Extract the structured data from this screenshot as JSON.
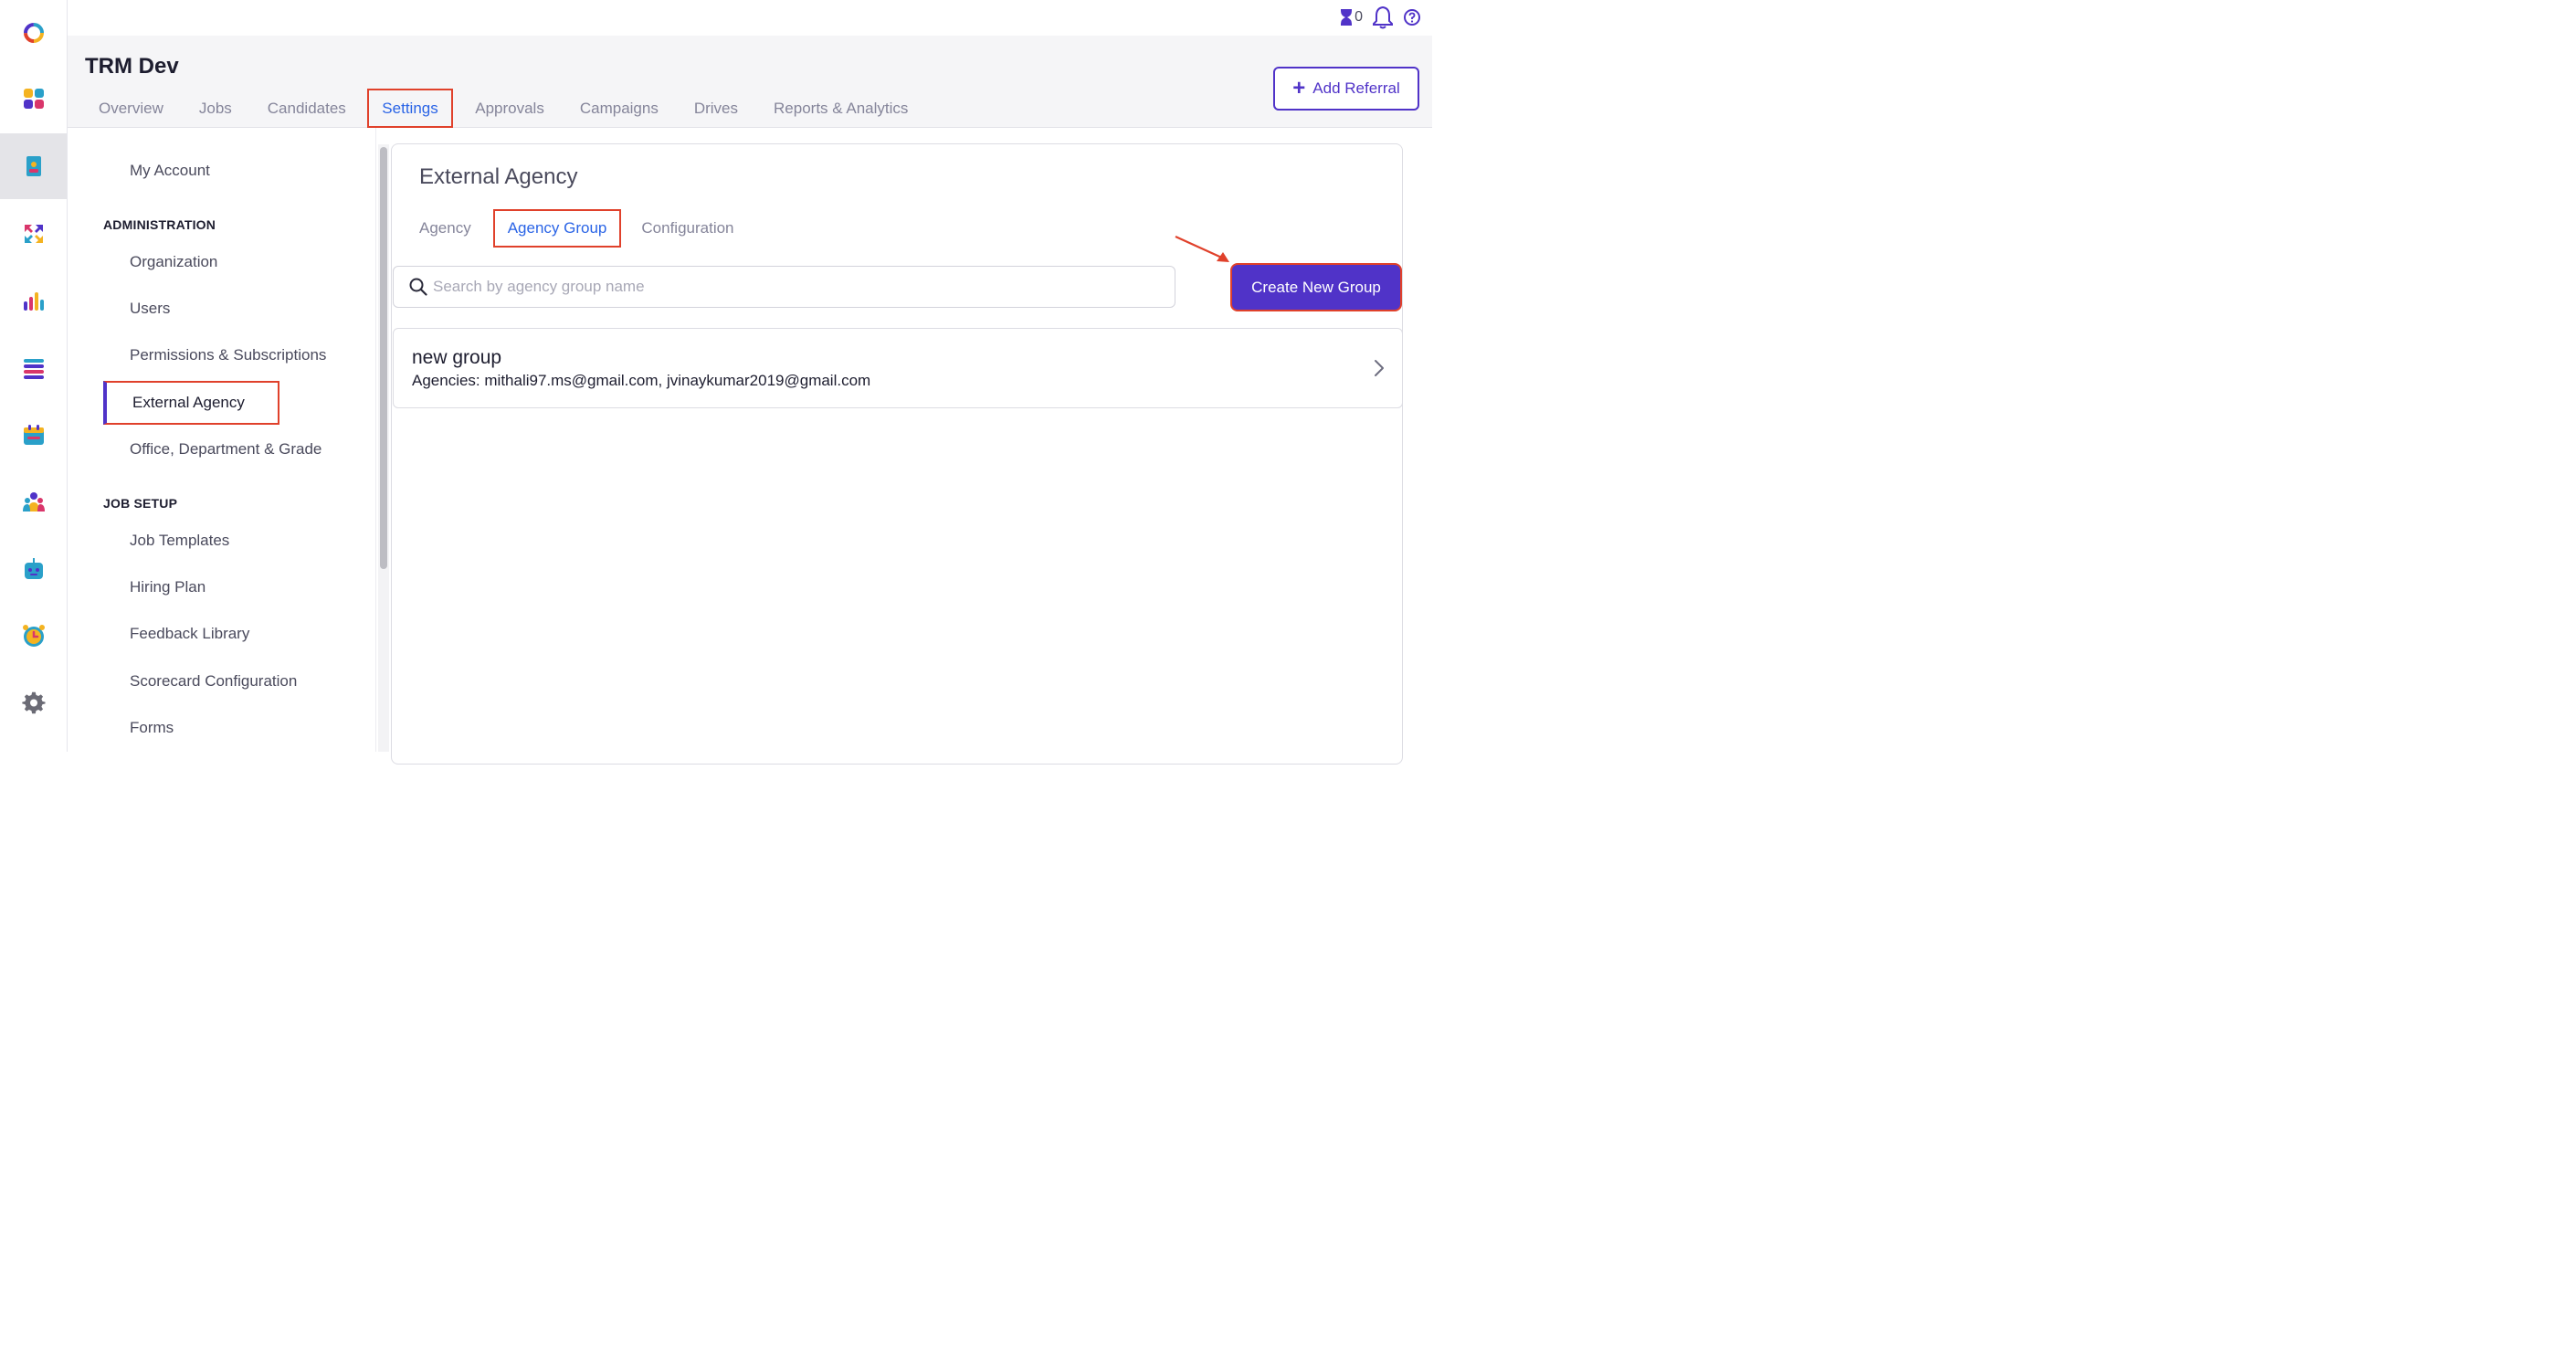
{
  "header": {
    "app_title": "TRM Dev",
    "add_referral_label": "Add Referral",
    "timer_count": "0",
    "nav_tabs": [
      {
        "label": "Overview"
      },
      {
        "label": "Jobs"
      },
      {
        "label": "Candidates"
      },
      {
        "label": "Settings",
        "active": true
      },
      {
        "label": "Approvals"
      },
      {
        "label": "Campaigns"
      },
      {
        "label": "Drives"
      },
      {
        "label": "Reports & Analytics"
      }
    ]
  },
  "rail": {
    "icons": [
      "logo-icon",
      "dashboard-icon",
      "jobs-document-icon",
      "referral-arrows-icon",
      "analytics-icon",
      "list-icon",
      "calendar-icon",
      "people-icon",
      "bot-icon",
      "alarm-clock-icon",
      "settings-gear-icon"
    ],
    "active": "jobs-document-icon"
  },
  "settings_menu": {
    "my_account": "My Account",
    "administration_heading": "ADMINISTRATION",
    "administration_items": [
      "Organization",
      "Users",
      "Permissions & Subscriptions",
      "External Agency",
      "Office, Department & Grade"
    ],
    "job_setup_heading": "JOB SETUP",
    "job_setup_items": [
      "Job Templates",
      "Hiring Plan",
      "Feedback Library",
      "Scorecard Configuration",
      "Forms"
    ],
    "active_item": "External Agency"
  },
  "main": {
    "title": "External Agency",
    "sub_tabs": [
      {
        "label": "Agency"
      },
      {
        "label": "Agency Group",
        "active": true
      },
      {
        "label": "Configuration"
      }
    ],
    "search_placeholder": "Search by agency group name",
    "create_button_label": "Create New Group",
    "groups": [
      {
        "name": "new group",
        "agencies_text": "Agencies: mithali97.ms@gmail.com, jvinaykumar2019@gmail.com"
      }
    ]
  },
  "colors": {
    "accent": "#5033c8",
    "active_tab_text": "#2a64e6",
    "highlight_box": "#e0412b"
  }
}
